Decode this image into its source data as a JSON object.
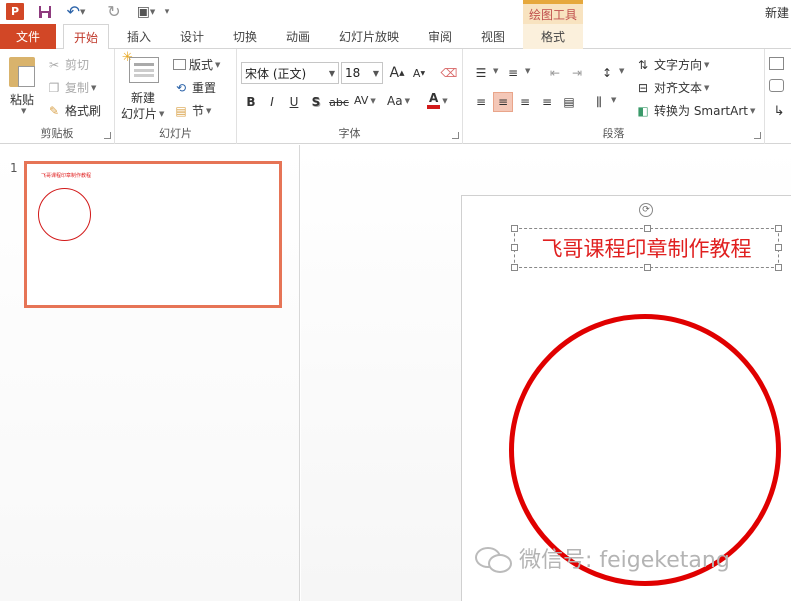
{
  "app": {
    "logo_letter": "P",
    "window_title": "新建",
    "context_tab_group": "绘图工具"
  },
  "tabs": [
    "文件",
    "开始",
    "插入",
    "设计",
    "切换",
    "动画",
    "幻灯片放映",
    "审阅",
    "视图",
    "格式"
  ],
  "ribbon": {
    "clipboard": {
      "paste": "粘贴",
      "cut": "剪切",
      "copy": "复制",
      "format_painter": "格式刷",
      "label": "剪贴板"
    },
    "slides": {
      "new_slide_line1": "新建",
      "new_slide_line2": "幻灯片",
      "layout": "版式",
      "reset": "重置",
      "section": "节",
      "label": "幻灯片"
    },
    "font": {
      "font_name": "宋体 (正文)",
      "font_size": "18",
      "grow": "A",
      "shrink": "A",
      "bold": "B",
      "italic": "I",
      "underline": "U",
      "shadow": "S",
      "strike": "abc",
      "spacing": "AV",
      "case": "Aa",
      "color": "A",
      "label": "字体"
    },
    "paragraph": {
      "text_direction": "文字方向",
      "align_text": "对齐文本",
      "smartart": "转换为 SmartArt",
      "label": "段落"
    }
  },
  "thumbnail": {
    "number": "1",
    "title": "飞哥课程印章制作教程"
  },
  "slide": {
    "title": "飞哥课程印章制作教程",
    "accent_color": "#e00000"
  },
  "watermark": {
    "text": "微信号: feigeketang"
  }
}
